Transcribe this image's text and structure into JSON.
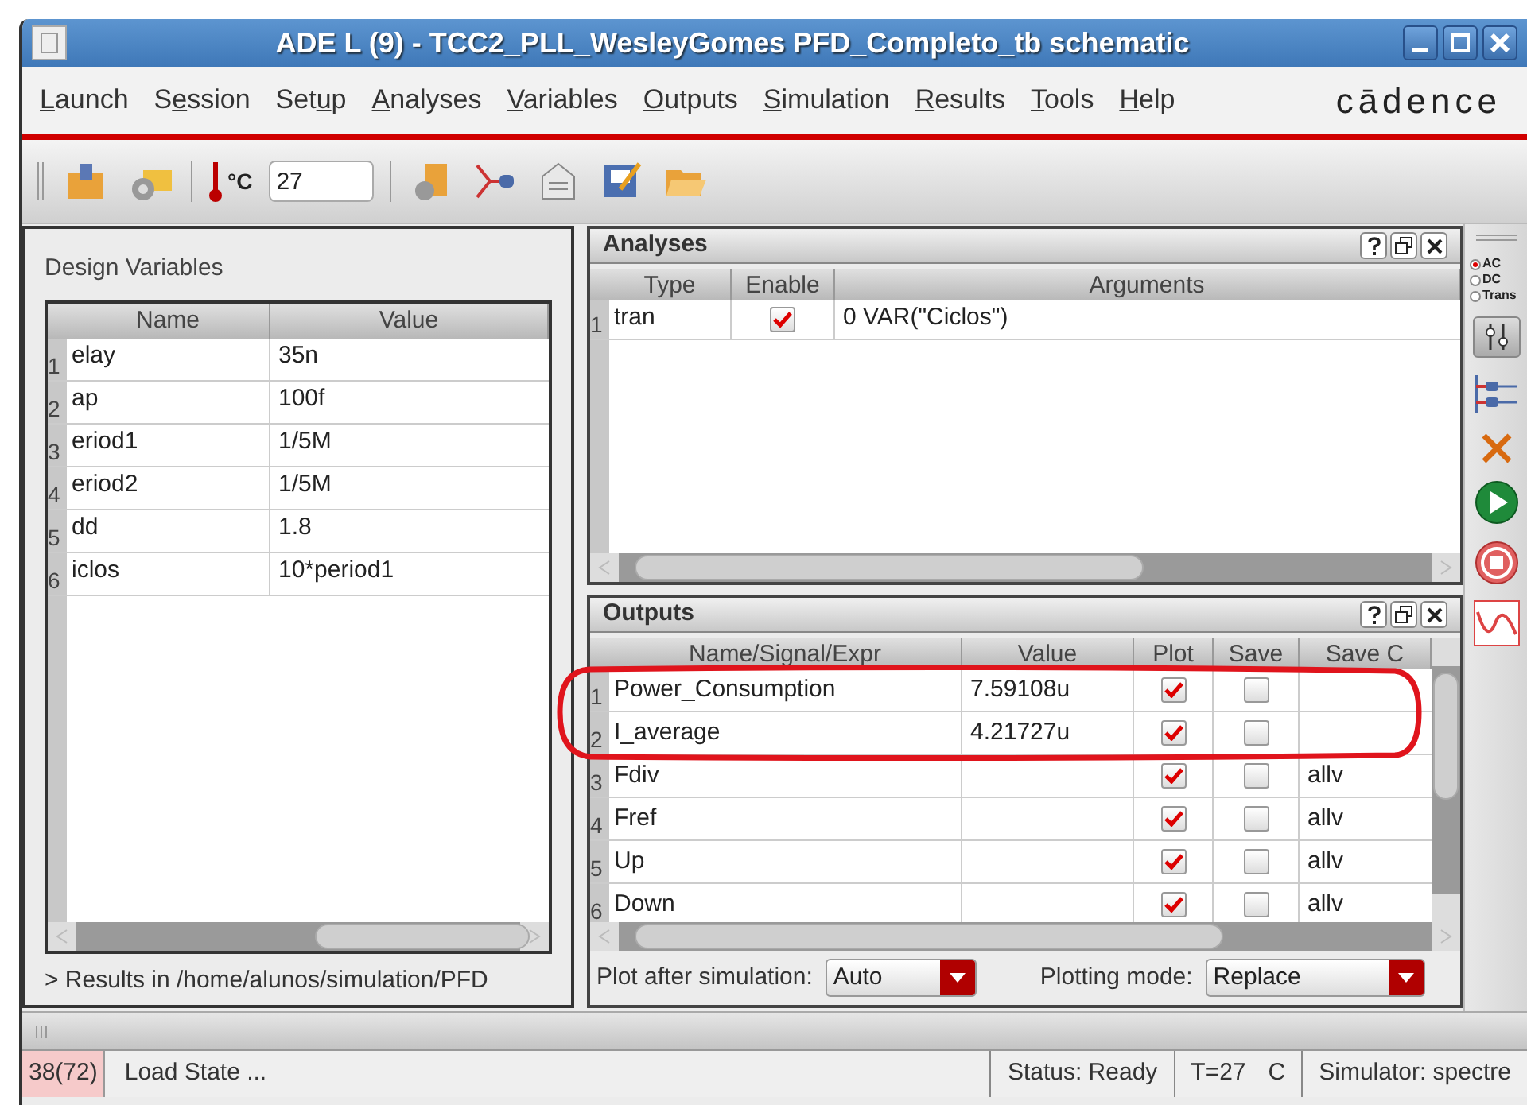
{
  "window": {
    "title": "ADE L (9) - TCC2_PLL_WesleyGomes PFD_Completo_tb schematic"
  },
  "menu": [
    {
      "key": "L",
      "after": "aunch"
    },
    {
      "before": "S",
      "key": "e",
      "after": "ssion"
    },
    {
      "before": "Set",
      "key": "u",
      "after": "p"
    },
    {
      "key": "A",
      "after": "nalyses"
    },
    {
      "key": "V",
      "after": "ariables"
    },
    {
      "key": "O",
      "after": "utputs"
    },
    {
      "key": "S",
      "after": "imulation"
    },
    {
      "key": "R",
      "after": "esults"
    },
    {
      "key": "T",
      "after": "ools"
    },
    {
      "key": "H",
      "after": "elp"
    }
  ],
  "logo": "cādence",
  "toolbar": {
    "temperature_unit": "°C",
    "temperature": "27"
  },
  "design_variables": {
    "title": "Design Variables",
    "columns": [
      "Name",
      "Value"
    ],
    "rows": [
      {
        "index": "1",
        "name": "elay",
        "value": "35n"
      },
      {
        "index": "2",
        "name": "ap",
        "value": "100f"
      },
      {
        "index": "3",
        "name": "eriod1",
        "value": "1/5M"
      },
      {
        "index": "4",
        "name": "eriod2",
        "value": "1/5M"
      },
      {
        "index": "5",
        "name": "dd",
        "value": "1.8"
      },
      {
        "index": "6",
        "name": "iclos",
        "value": "10*period1"
      }
    ],
    "results_text": "> Results in /home/alunos/simulation/PFD"
  },
  "analyses": {
    "title": "Analyses",
    "columns": [
      "Type",
      "Enable",
      "Arguments"
    ],
    "rows": [
      {
        "index": "1",
        "type": "tran",
        "enabled": true,
        "arguments": "0 VAR(\"Ciclos\")"
      }
    ]
  },
  "outputs": {
    "title": "Outputs",
    "columns": [
      "Name/Signal/Expr",
      "Value",
      "Plot",
      "Save",
      "Save C"
    ],
    "rows": [
      {
        "index": "1",
        "name": "Power_Consumption",
        "value": "7.59108u",
        "plot": true,
        "save": false
      },
      {
        "index": "2",
        "name": "I_average",
        "value": "4.21727u",
        "plot": true,
        "save": false
      },
      {
        "index": "3",
        "name": "Fdiv",
        "plot": true,
        "save": false,
        "save_options": "allv"
      },
      {
        "index": "4",
        "name": "Fref",
        "plot": true,
        "save": false,
        "save_options": "allv"
      },
      {
        "index": "5",
        "name": "Up",
        "plot": true,
        "save": false,
        "save_options": "allv"
      },
      {
        "index": "6",
        "name": "Down",
        "plot": true,
        "save": false,
        "save_options": "allv"
      }
    ],
    "plot_after": {
      "label": "Plot after simulation:",
      "value": "Auto"
    },
    "plotting_mode": {
      "label": "Plotting mode:",
      "value": "Replace"
    }
  },
  "side_toolbar": {
    "analysis_types": [
      {
        "label": "AC",
        "selected": true
      },
      {
        "label": "DC",
        "selected": false
      },
      {
        "label": "Trans",
        "selected": false
      }
    ]
  },
  "status_bar": {
    "counter": "38(72)",
    "message": "Load State ...",
    "status": "Status: Ready",
    "temperature": "T=27",
    "unit": "C",
    "simulator": "Simulator: spectre"
  }
}
